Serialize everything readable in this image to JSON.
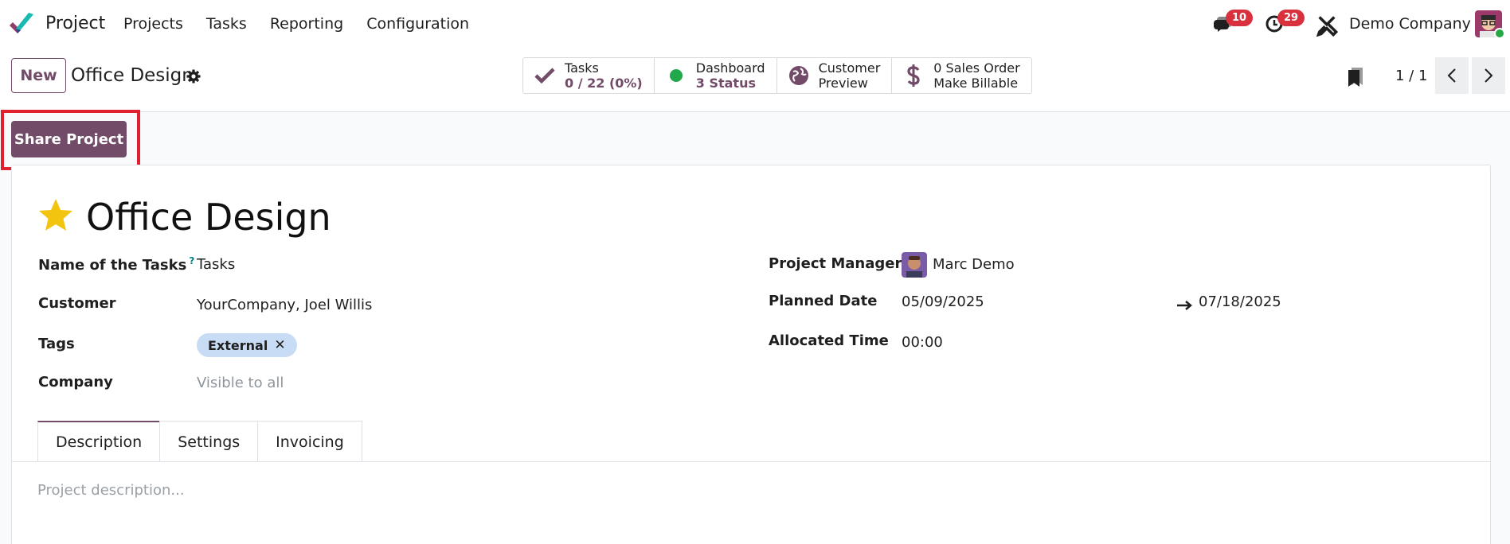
{
  "navbar": {
    "app_name": "Project",
    "menu": [
      "Projects",
      "Tasks",
      "Reporting",
      "Configuration"
    ],
    "messages_count": "10",
    "activities_count": "29",
    "company": "Demo Company"
  },
  "control": {
    "new_label": "New",
    "breadcrumb": "Office Design",
    "stats": [
      {
        "icon": "check-icon",
        "line1": "Tasks",
        "line2": "0 / 22 (0%)"
      },
      {
        "icon": "status-dot-icon",
        "line1": "Dashboard",
        "line2": "3 Status"
      },
      {
        "icon": "globe-icon",
        "line1": "Customer",
        "line2": "Preview"
      },
      {
        "icon": "dollar-icon",
        "line1": "0 Sales Order",
        "line2": "Make Billable"
      }
    ],
    "pager": "1 / 1"
  },
  "share_label": "Share Project",
  "record": {
    "title": "Office Design",
    "starred": true,
    "left_fields": {
      "tasks_name": {
        "label": "Name of the Tasks",
        "help": "?",
        "value": "Tasks"
      },
      "customer": {
        "label": "Customer",
        "value": "YourCompany, Joel Willis"
      },
      "tags": {
        "label": "Tags",
        "values": [
          "External"
        ]
      },
      "company": {
        "label": "Company",
        "value": "Visible to all"
      }
    },
    "right_fields": {
      "manager": {
        "label": "Project Manager",
        "value": "Marc Demo"
      },
      "planned": {
        "label": "Planned Date",
        "start": "05/09/2025",
        "end": "07/18/2025"
      },
      "allocated": {
        "label": "Allocated Time",
        "value": "00:00"
      }
    },
    "tabs": [
      "Description",
      "Settings",
      "Invoicing"
    ],
    "active_tab": "Description",
    "description_placeholder": "Project description..."
  },
  "colors": {
    "brand": "#714b67",
    "badge": "#d9303e",
    "tag": "#c8dcf5",
    "star": "#f3c40f",
    "highlight": "#e0202e"
  }
}
